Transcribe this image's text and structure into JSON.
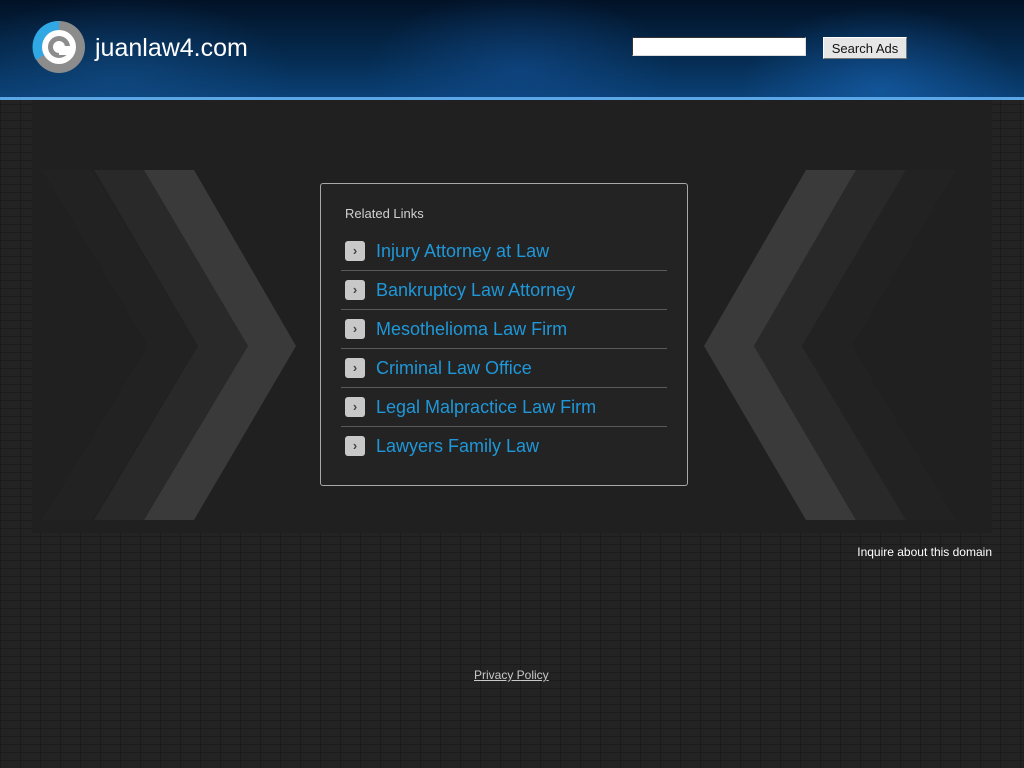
{
  "header": {
    "site_title": "juanlaw4.com",
    "search": {
      "value": "",
      "placeholder": ""
    },
    "search_button_label": "Search Ads",
    "logo_icon": "domain-logo-icon"
  },
  "related_links": {
    "heading": "Related Links",
    "items": [
      {
        "label": "Injury Attorney at Law",
        "icon": "chevron-right-icon"
      },
      {
        "label": "Bankruptcy Law Attorney",
        "icon": "chevron-right-icon"
      },
      {
        "label": "Mesothelioma Law Firm",
        "icon": "chevron-right-icon"
      },
      {
        "label": "Criminal Law Office",
        "icon": "chevron-right-icon"
      },
      {
        "label": "Legal Malpractice Law Firm",
        "icon": "chevron-right-icon"
      },
      {
        "label": "Lawyers Family Law",
        "icon": "chevron-right-icon"
      }
    ],
    "arrow_glyph": "›"
  },
  "footer": {
    "inquire_label": "Inquire about this domain",
    "privacy_label": "Privacy Policy"
  },
  "colors": {
    "link": "#1f97d8",
    "header_accent_line": "#5aa6e6"
  }
}
